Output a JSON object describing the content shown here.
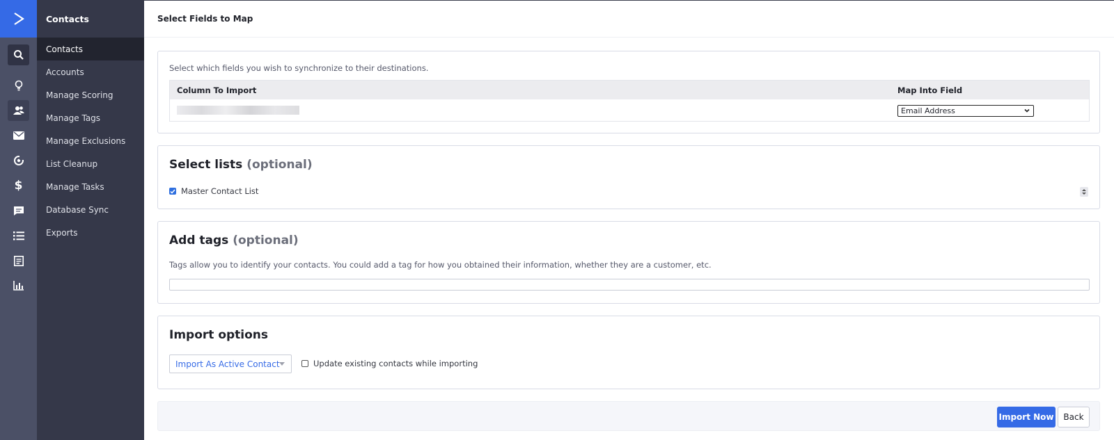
{
  "rail": {
    "icons": [
      "search-icon",
      "lightbulb-icon",
      "contacts-icon",
      "email-icon",
      "automation-icon",
      "deals-icon",
      "conversations-icon",
      "lists-icon",
      "forms-icon",
      "reports-icon"
    ],
    "active": "contacts-icon"
  },
  "subnav": {
    "header": "Contacts",
    "items": [
      {
        "label": "Contacts"
      },
      {
        "label": "Accounts"
      },
      {
        "label": "Manage Scoring"
      },
      {
        "label": "Manage Tags"
      },
      {
        "label": "Manage Exclusions"
      },
      {
        "label": "List Cleanup"
      },
      {
        "label": "Manage Tasks"
      },
      {
        "label": "Database Sync"
      },
      {
        "label": "Exports"
      }
    ]
  },
  "page": {
    "title": "Select Fields to Map"
  },
  "mapping": {
    "hint": "Select which fields you wish to synchronize to their destinations.",
    "col_import": "Column To Import",
    "col_map": "Map Into Field",
    "selected_field": "Email Address"
  },
  "lists": {
    "title": "Select lists",
    "optional": "(optional)",
    "items": [
      {
        "label": "Master Contact List",
        "checked": true
      }
    ]
  },
  "tags": {
    "title": "Add tags",
    "optional": "(optional)",
    "hint": "Tags allow you to identify your contacts. You could add a tag for how you obtained their information, whether they are a customer, etc.",
    "value": ""
  },
  "import_options": {
    "title": "Import options",
    "status_select": "Import As Active Contact",
    "update_label": "Update existing contacts while importing",
    "update_checked": false
  },
  "footer": {
    "import_label": "Import Now",
    "back_label": "Back"
  },
  "colors": {
    "brand": "#356ae6",
    "rail": "#4b5066",
    "subnav": "#353849"
  }
}
